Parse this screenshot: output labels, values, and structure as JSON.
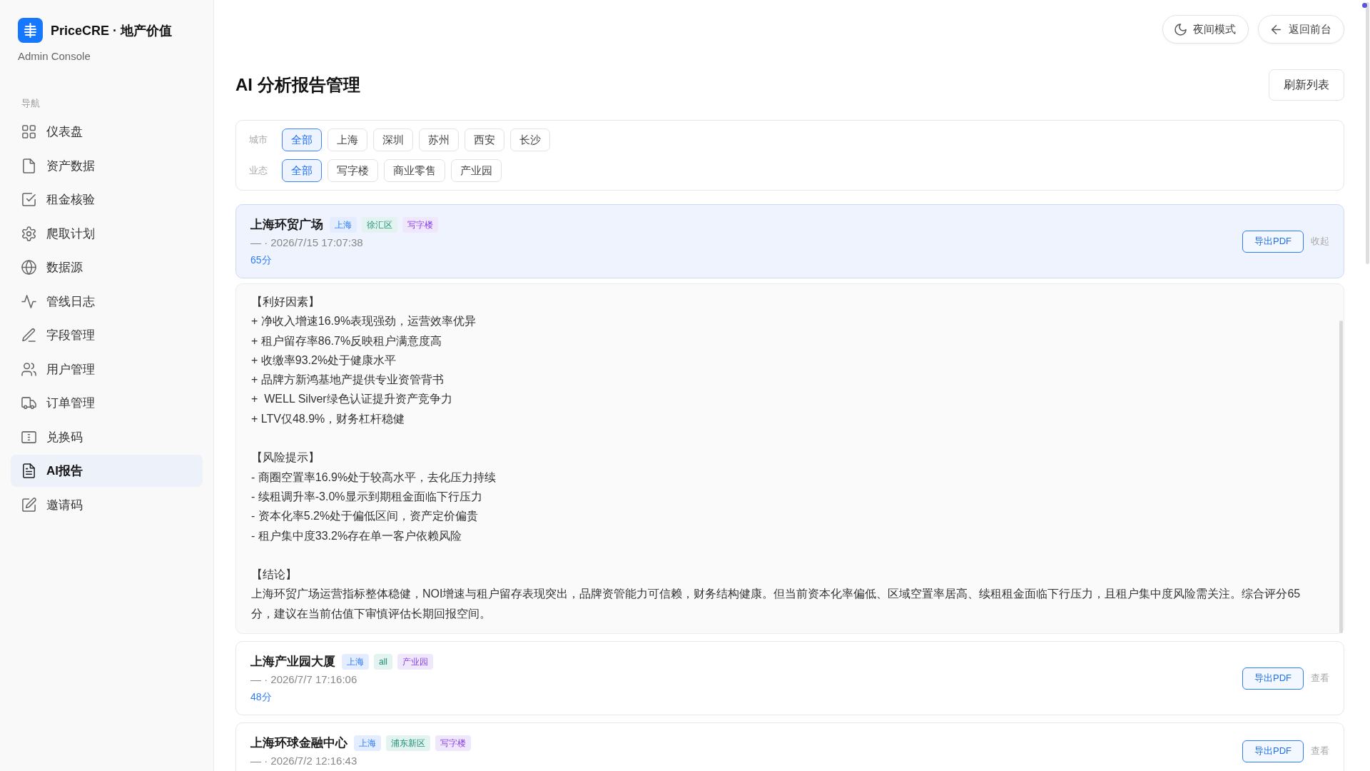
{
  "sidebar": {
    "brand": "PriceCRE · 地产价值",
    "subtitle": "Admin Console",
    "section_label": "导航",
    "items": [
      {
        "label": "仪表盘",
        "selected": false
      },
      {
        "label": "资产数据",
        "selected": false
      },
      {
        "label": "租金核验",
        "selected": false
      },
      {
        "label": "爬取计划",
        "selected": false
      },
      {
        "label": "数据源",
        "selected": false
      },
      {
        "label": "管线日志",
        "selected": false
      },
      {
        "label": "字段管理",
        "selected": false
      },
      {
        "label": "用户管理",
        "selected": false
      },
      {
        "label": "订单管理",
        "selected": false
      },
      {
        "label": "兑换码",
        "selected": false
      },
      {
        "label": "AI报告",
        "selected": true
      },
      {
        "label": "邀请码",
        "selected": false
      }
    ]
  },
  "top_actions": [
    {
      "label": "夜间模式"
    },
    {
      "label": "返回前台"
    }
  ],
  "page": {
    "title": "AI 分析报告管理",
    "refresh_button": "刷新列表"
  },
  "filters": [
    {
      "label": "城市",
      "options": [
        {
          "label": "全部",
          "selected": true
        },
        {
          "label": "上海",
          "selected": false
        },
        {
          "label": "深圳",
          "selected": false
        },
        {
          "label": "苏州",
          "selected": false
        },
        {
          "label": "西安",
          "selected": false
        },
        {
          "label": "长沙",
          "selected": false
        }
      ]
    },
    {
      "label": "业态",
      "options": [
        {
          "label": "全部",
          "selected": true
        },
        {
          "label": "写字楼",
          "selected": false
        },
        {
          "label": "商业零售",
          "selected": false
        },
        {
          "label": "产业园",
          "selected": false
        }
      ]
    }
  ],
  "reports": [
    {
      "title": "上海环贸广场",
      "tags": [
        {
          "label": "上海",
          "kind": "city"
        },
        {
          "label": "徐汇区",
          "kind": "district"
        },
        {
          "label": "写字楼",
          "kind": "type"
        }
      ],
      "meta": "— · 2026/7/15 17:07:38",
      "score": "65分",
      "export_button": "导出PDF",
      "toggle": "收起",
      "expanded": true,
      "content": [
        {
          "heading": "【利好因素】",
          "lines": [
            "+ 净收入增速16.9%表现强劲，运营效率优异",
            "+ 租户留存率86.7%反映租户满意度高",
            "+ 收缴率93.2%处于健康水平",
            "+ 品牌方新鸿基地产提供专业资管背书",
            "+  WELL Silver绿色认证提升资产竞争力",
            "+ LTV仅48.9%，财务杠杆稳健"
          ]
        },
        {
          "heading": "【风险提示】",
          "lines": [
            "- 商圈空置率16.9%处于较高水平，去化压力持续",
            "- 续租调升率-3.0%显示到期租金面临下行压力",
            "- 资本化率5.2%处于偏低区间，资产定价偏贵",
            "- 租户集中度33.2%存在单一客户依赖风险"
          ]
        },
        {
          "heading": "【结论】",
          "lines": [
            "上海环贸广场运营指标整体稳健，NOI增速与租户留存表现突出，品牌资管能力可信赖，财务结构健康。但当前资本化率偏低、区域空置率居高、续租租金面临下行压力，且租户集中度风险需关注。综合评分65分，建议在当前估值下审慎评估长期回报空间。"
          ]
        }
      ]
    },
    {
      "title": "上海产业园大厦",
      "tags": [
        {
          "label": "上海",
          "kind": "city"
        },
        {
          "label": "all",
          "kind": "district"
        },
        {
          "label": "产业园",
          "kind": "type"
        }
      ],
      "meta": "— · 2026/7/7 17:16:06",
      "score": "48分",
      "export_button": "导出PDF",
      "toggle": "查看",
      "expanded": false
    },
    {
      "title": "上海环球金融中心",
      "tags": [
        {
          "label": "上海",
          "kind": "city"
        },
        {
          "label": "浦东新区",
          "kind": "district"
        },
        {
          "label": "写字楼",
          "kind": "type"
        }
      ],
      "meta": "— · 2026/7/2 12:16:43",
      "export_button": "导出PDF",
      "toggle": "查看",
      "expanded": false
    }
  ]
}
